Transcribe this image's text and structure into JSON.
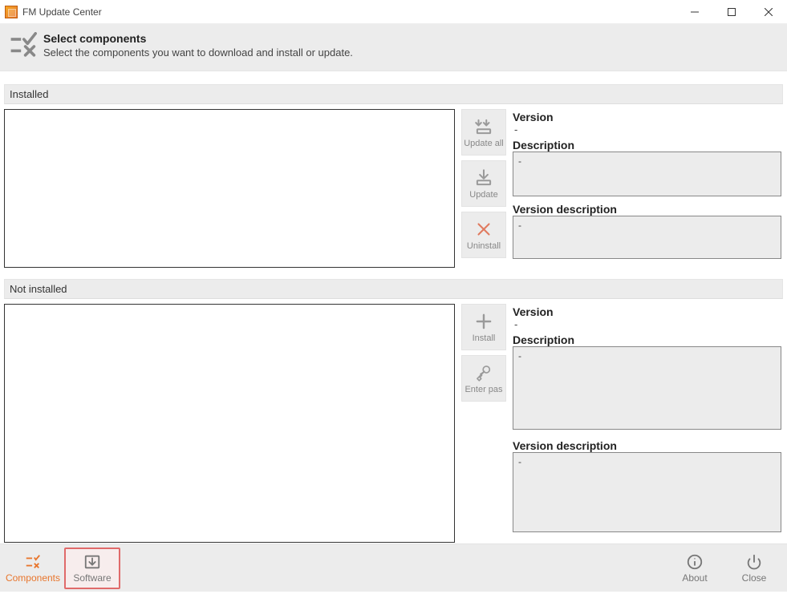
{
  "window": {
    "title": "FM Update Center"
  },
  "header": {
    "title": "Select components",
    "subtitle": "Select the components you want to download and install or update."
  },
  "sections": {
    "installed_label": "Installed",
    "not_installed_label": "Not installed"
  },
  "buttons": {
    "update_all": "Update all",
    "update": "Update",
    "uninstall": "Uninstall",
    "install": "Install",
    "enter_password": "Enter pas"
  },
  "details_labels": {
    "version": "Version",
    "description": "Description",
    "version_description": "Version description"
  },
  "installed_details": {
    "version_value": "-",
    "description_value": "-",
    "version_description_value": "-"
  },
  "notinstalled_details": {
    "version_value": "-",
    "description_value": "-",
    "version_description_value": "-"
  },
  "bottom": {
    "components": "Components",
    "software": "Software",
    "about": "About",
    "close": "Close"
  }
}
